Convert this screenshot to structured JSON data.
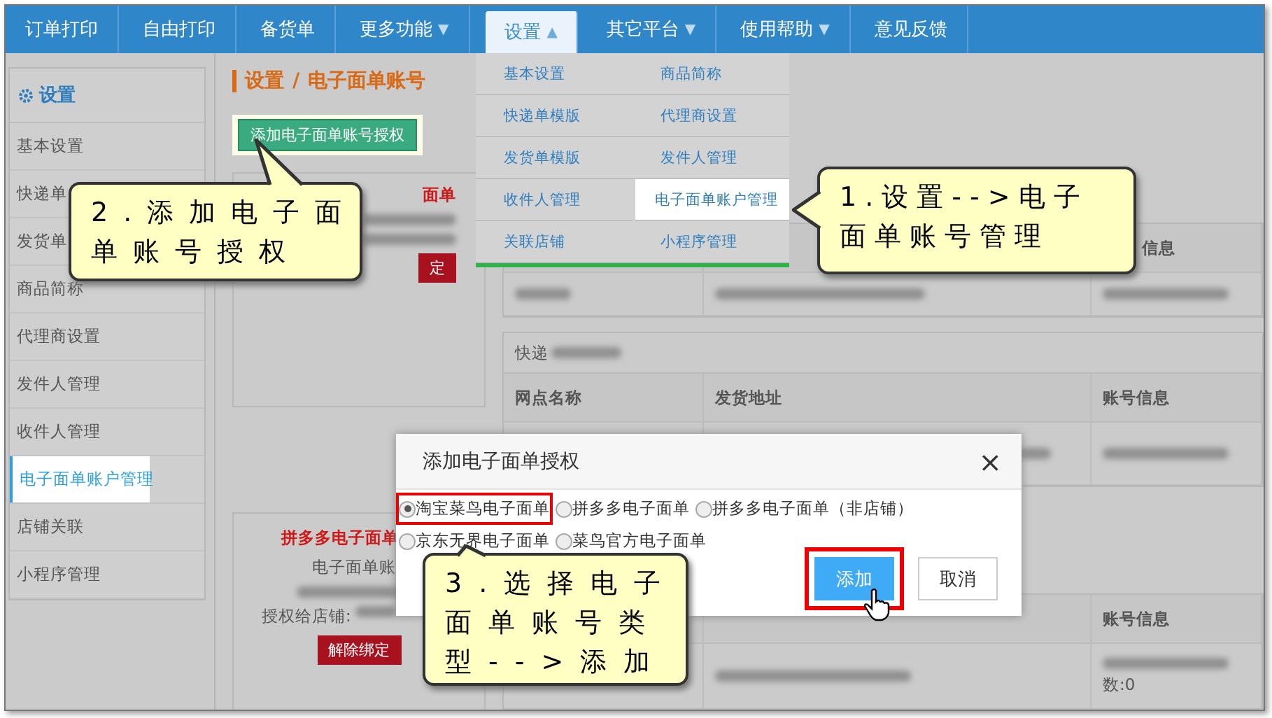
{
  "nav": [
    {
      "label": "订单打印",
      "selected": false
    },
    {
      "label": "自由打印",
      "selected": false
    },
    {
      "label": "备货单",
      "selected": false
    },
    {
      "label": "更多功能",
      "caret": "▼",
      "selected": false
    },
    {
      "label": "设置",
      "caret": "▲",
      "selected": true
    },
    {
      "label": "其它平台",
      "caret": "▼",
      "selected": false
    },
    {
      "label": "使用帮助",
      "caret": "▼",
      "selected": false
    },
    {
      "label": "意见反馈",
      "selected": false
    }
  ],
  "menu": {
    "items": [
      {
        "label": "基本设置",
        "selected": false
      },
      {
        "label": "商品简称",
        "selected": false
      },
      {
        "label": "快递单模版",
        "selected": false
      },
      {
        "label": "代理商设置",
        "selected": false
      },
      {
        "label": "发货单模版",
        "selected": false
      },
      {
        "label": "发件人管理",
        "selected": false
      },
      {
        "label": "收件人管理",
        "selected": false
      },
      {
        "label": "电子面单账户管理",
        "selected": true
      },
      {
        "label": "关联店铺",
        "selected": false
      },
      {
        "label": "小程序管理",
        "selected": false
      }
    ]
  },
  "sidebar": {
    "title": "设置",
    "items": [
      {
        "label": "基本设置",
        "selected": false
      },
      {
        "label": "快递单",
        "selected": false
      },
      {
        "label": "发货单",
        "selected": false
      },
      {
        "label": "商品简称",
        "selected": false
      },
      {
        "label": "代理商设置",
        "selected": false
      },
      {
        "label": "发件人管理",
        "selected": false
      },
      {
        "label": "收件人管理",
        "selected": false
      },
      {
        "label": "电子面单账户管理",
        "selected": true
      },
      {
        "label": "店铺关联",
        "selected": false
      },
      {
        "label": "小程序管理",
        "selected": false
      }
    ]
  },
  "breadcrumb": {
    "section": "设置",
    "separator": "/",
    "page": "电子面单账号"
  },
  "add_auth_button": "添加电子面单账号授权",
  "cards": [
    {
      "title": "面单",
      "button": "定"
    },
    {
      "title": "拼多多电子面单",
      "subtitle": "电子面单账",
      "shop_label": "授权给店铺:",
      "button": "解除绑定"
    }
  ],
  "tables": [
    {
      "columns": [
        "",
        "",
        "信息"
      ]
    },
    {
      "caption": "快递",
      "columns": [
        "网点名称",
        "发货地址",
        "账号信息"
      ]
    },
    {
      "columns": [
        "",
        "",
        "账号信息"
      ],
      "cells": [
        "",
        "",
        "数:0"
      ]
    }
  ],
  "modal": {
    "title": "添加电子面单授权",
    "close": "×",
    "options": [
      {
        "label": "淘宝菜鸟电子面单",
        "selected": true,
        "highlighted": true
      },
      {
        "label": "拼多多电子面单",
        "selected": false,
        "highlighted": false
      },
      {
        "label": "拼多多电子面单（非店铺）",
        "selected": false,
        "highlighted": false
      },
      {
        "label": "京东无界电子面单",
        "selected": false,
        "highlighted": false
      },
      {
        "label": "菜鸟官方电子面单",
        "selected": false,
        "highlighted": false
      }
    ],
    "buttons": [
      {
        "label": "添加",
        "kind": "primary",
        "highlighted": true
      },
      {
        "label": "取消",
        "kind": "default",
        "highlighted": false
      }
    ]
  },
  "callouts": [
    {
      "text": "1.设置-->电子面单账号管理"
    },
    {
      "text": "2.添加电子面单账号授权"
    },
    {
      "text": "3.选择电子面单账号类型-->添加"
    }
  ]
}
